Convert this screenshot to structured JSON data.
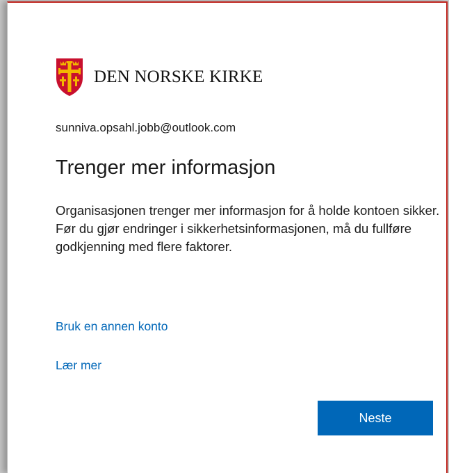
{
  "brand": {
    "name": "DEN NORSKE KIRKE",
    "logo_icon": "church-shield-cross-icon",
    "colors": {
      "shield": "#c8102e",
      "cross": "#f3b700",
      "border": "#c0261f"
    }
  },
  "account": {
    "email": "sunniva.opsahl.jobb@outlook.com"
  },
  "content": {
    "title": "Trenger mer informasjon",
    "description": "Organisasjonen trenger mer informasjon for å holde kontoen sikker. Før du gjør endringer i sikkerhetsinformasjonen, må du fullføre godkjenning med flere faktorer."
  },
  "links": {
    "use_other_account": "Bruk en annen konto",
    "learn_more": "Lær mer"
  },
  "actions": {
    "next_label": "Neste",
    "accent": "#0067b8"
  }
}
